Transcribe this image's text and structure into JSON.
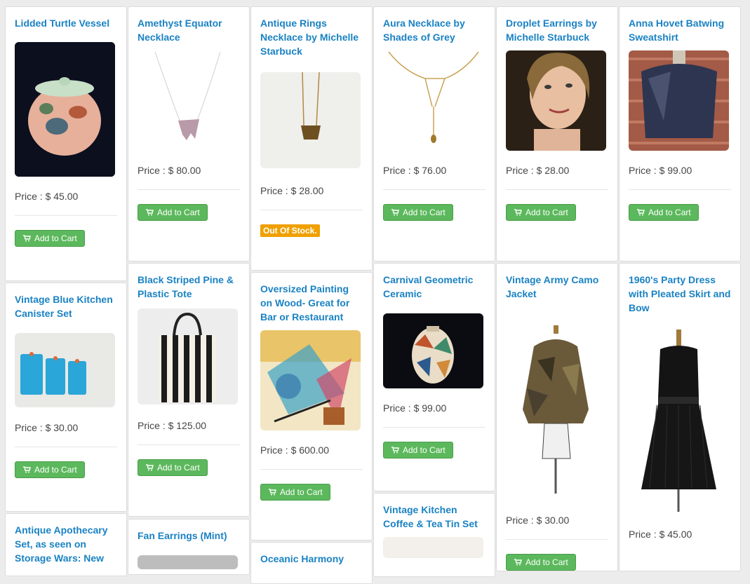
{
  "ui": {
    "price_prefix": "Price : $ ",
    "add_to_cart": "Add to Cart",
    "out_of_stock": "Out Of Stock."
  },
  "colors": {
    "title_link": "#1a82c3",
    "button": "#5cb85c",
    "out_of_stock": "#f0a000"
  },
  "icons": {
    "cart": "cart-icon"
  },
  "products": [
    {
      "title": "Lidded Turtle Vessel",
      "price": "45.00",
      "in_stock": true
    },
    {
      "title": "Vintage Blue Kitchen Canister Set",
      "price": "30.00",
      "in_stock": true
    },
    {
      "title": "Antique Apothecary Set, as seen on Storage Wars: New",
      "price": "",
      "in_stock": true
    },
    {
      "title": "Amethyst Equator Necklace",
      "price": "80.00",
      "in_stock": true
    },
    {
      "title": "Black Striped Pine & Plastic Tote",
      "price": "125.00",
      "in_stock": true
    },
    {
      "title": "Fan Earrings (Mint)",
      "price": "",
      "in_stock": true
    },
    {
      "title": "Antique Rings Necklace by Michelle Starbuck",
      "price": "28.00",
      "in_stock": false
    },
    {
      "title": "Oversized Painting on Wood- Great for Bar or Restaurant",
      "price": "600.00",
      "in_stock": true
    },
    {
      "title": "Oceanic Harmony",
      "price": "",
      "in_stock": true
    },
    {
      "title": "Aura Necklace by Shades of Grey",
      "price": "76.00",
      "in_stock": true
    },
    {
      "title": "Carnival Geometric Ceramic",
      "price": "99.00",
      "in_stock": true
    },
    {
      "title": "Vintage Kitchen Coffee & Tea Tin Set",
      "price": "",
      "in_stock": true
    },
    {
      "title": "Droplet Earrings by Michelle Starbuck",
      "price": "28.00",
      "in_stock": true
    },
    {
      "title": "Vintage Army Camo Jacket",
      "price": "30.00",
      "in_stock": true
    },
    {
      "title": "Anna Hovet Batwing Sweatshirt",
      "price": "99.00",
      "in_stock": true
    },
    {
      "title": "1960's Party Dress with Pleated Skirt and Bow",
      "price": "45.00",
      "in_stock": true
    }
  ]
}
